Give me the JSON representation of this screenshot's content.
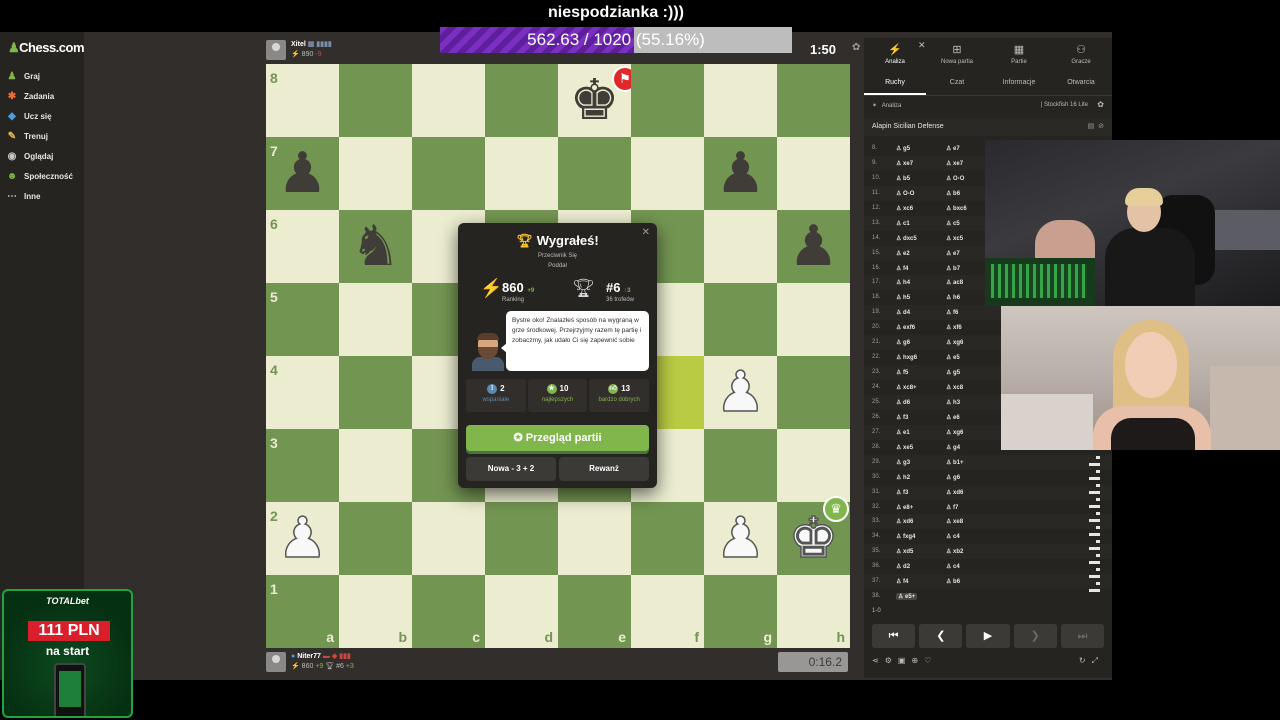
{
  "stream": {
    "title": "niespodzianka :)))",
    "progress_text": "562.63 / 1020 (55.16%)",
    "progress_fraction": 0.5516
  },
  "sidebar": {
    "logo": "Chess.com",
    "items": [
      {
        "label": "Graj",
        "icon": "pawn-icon",
        "color": "#81b64c"
      },
      {
        "label": "Zadania",
        "icon": "puzzle-icon",
        "color": "#f36e32"
      },
      {
        "label": "Ucz się",
        "icon": "learn-icon",
        "color": "#4a9ee0"
      },
      {
        "label": "Trenuj",
        "icon": "train-icon",
        "color": "#e8b84a"
      },
      {
        "label": "Oglądaj",
        "icon": "watch-icon",
        "color": "#c6c6c6"
      },
      {
        "label": "Społeczność",
        "icon": "community-icon",
        "color": "#81b64c"
      },
      {
        "label": "Inne",
        "icon": "more-icon",
        "color": "#c6c6c6"
      }
    ]
  },
  "player_top": {
    "name": "Xitel",
    "flag": "▦ ▮▮▮▮",
    "rating": "890",
    "delta": "-9",
    "clock": "1:50"
  },
  "player_bottom": {
    "name": "Niter77",
    "badges": "▬ ◆ ▮▮▮",
    "rating": "860",
    "delta": "+9",
    "trophy_rank": "#6",
    "trophy_delta": "+3",
    "clock": "0:16.2"
  },
  "board": {
    "ranks": [
      "8",
      "7",
      "6",
      "5",
      "4",
      "3",
      "2",
      "1"
    ],
    "files": [
      "a",
      "b",
      "c",
      "d",
      "e",
      "f",
      "g",
      "h"
    ],
    "pieces": [
      {
        "square": "e8",
        "glyph": "♚",
        "color": "black",
        "name": "black-king"
      },
      {
        "square": "a7",
        "glyph": "♟",
        "color": "black",
        "name": "black-pawn-a7"
      },
      {
        "square": "g7",
        "glyph": "♟",
        "color": "black",
        "name": "black-pawn-g7"
      },
      {
        "square": "b6",
        "glyph": "♞",
        "color": "black",
        "name": "black-knight-b6"
      },
      {
        "square": "h6",
        "glyph": "♟",
        "color": "black",
        "name": "black-pawn-h6"
      },
      {
        "square": "g4",
        "glyph": "♟",
        "color": "white",
        "name": "white-pawn-g4"
      },
      {
        "square": "a2",
        "glyph": "♟",
        "color": "white",
        "name": "white-pawn-a2"
      },
      {
        "square": "g2",
        "glyph": "♟",
        "color": "white",
        "name": "white-pawn-g2"
      },
      {
        "square": "h2",
        "glyph": "♚",
        "color": "white",
        "name": "white-king"
      }
    ],
    "highlight": "f4"
  },
  "modal": {
    "title": "Wygrałeś!",
    "sub1": "Przeciwnik Się",
    "sub2": "Poddał",
    "rating_value": "860",
    "rating_delta": "+9",
    "rating_label": "Ranking",
    "trophy_value": "#6",
    "trophy_delta": "↑3",
    "trophy_label": "36 trofeów",
    "bubble": "Bystre oko! Znalazłeś sposób na wygraną w grze środkowej. Przejrzyjmy razem tę partię i zobaczmy, jak udało Ci się zapewnić sobie",
    "counts": [
      {
        "value": "2",
        "label": "wspaniałe",
        "color": "#5c8bb0"
      },
      {
        "value": "10",
        "label": "najlepszych",
        "color": "#81b64c"
      },
      {
        "value": "13",
        "label": "bardzo dobrych",
        "color": "#81b64c"
      }
    ],
    "review_label": "Przegląd partii",
    "new_label": "Nowa - 3 + 2",
    "rematch_label": "Rewanż"
  },
  "panel": {
    "tabs": [
      "Analiza",
      "Nowa partia",
      "Partie",
      "Gracze"
    ],
    "subtabs": [
      "Ruchy",
      "Czat",
      "Informacje",
      "Otwarcia"
    ],
    "analysis_label": "Analiza",
    "engine": "Stockfish 16 Lite",
    "opening": "Alapin Sicilian Defense",
    "moves": [
      {
        "n": "8.",
        "w": "g5",
        "b": "e7"
      },
      {
        "n": "9.",
        "w": "xe7",
        "b": "xe7"
      },
      {
        "n": "10.",
        "w": "b5",
        "b": "O-O"
      },
      {
        "n": "11.",
        "w": "O-O",
        "b": "b6"
      },
      {
        "n": "12.",
        "w": "xc6",
        "b": "bxc6"
      },
      {
        "n": "13.",
        "w": "c1",
        "b": "c5"
      },
      {
        "n": "14.",
        "w": "dxc5",
        "b": "xc5"
      },
      {
        "n": "15.",
        "w": "e2",
        "b": "e7"
      },
      {
        "n": "16.",
        "w": "f4",
        "b": "b7"
      },
      {
        "n": "17.",
        "w": "h4",
        "b": "ac8"
      },
      {
        "n": "18.",
        "w": "h5",
        "b": "h6"
      },
      {
        "n": "19.",
        "w": "d4",
        "b": "f6"
      },
      {
        "n": "20.",
        "w": "exf6",
        "b": "xf6"
      },
      {
        "n": "21.",
        "w": "g6",
        "b": "xg6"
      },
      {
        "n": "22.",
        "w": "hxg6",
        "b": "e5"
      },
      {
        "n": "23.",
        "w": "f5",
        "b": "g5"
      },
      {
        "n": "24.",
        "w": "xc8+",
        "b": "xc8"
      },
      {
        "n": "25.",
        "w": "d6",
        "b": "h3"
      },
      {
        "n": "26.",
        "w": "f3",
        "b": "e6"
      },
      {
        "n": "27.",
        "w": "e1",
        "b": "xg6"
      },
      {
        "n": "28.",
        "w": "xe5",
        "b": "g4"
      },
      {
        "n": "29.",
        "w": "g3",
        "b": "b1+"
      },
      {
        "n": "30.",
        "w": "h2",
        "b": "g6"
      },
      {
        "n": "31.",
        "w": "f3",
        "b": "xd6"
      },
      {
        "n": "32.",
        "w": "e8+",
        "b": "f7"
      },
      {
        "n": "33.",
        "w": "xd6",
        "b": "xe8"
      },
      {
        "n": "34.",
        "w": "fxg4",
        "b": "c4"
      },
      {
        "n": "35.",
        "w": "xd5",
        "b": "xb2"
      },
      {
        "n": "36.",
        "w": "d2",
        "b": "c4"
      },
      {
        "n": "37.",
        "w": "f4",
        "b": "b6"
      },
      {
        "n": "38.",
        "w": "e5+",
        "b": ""
      }
    ],
    "result": "1-0"
  },
  "ad": {
    "brand": "TOTALbet",
    "amount": "111 PLN",
    "sub": "na start"
  }
}
